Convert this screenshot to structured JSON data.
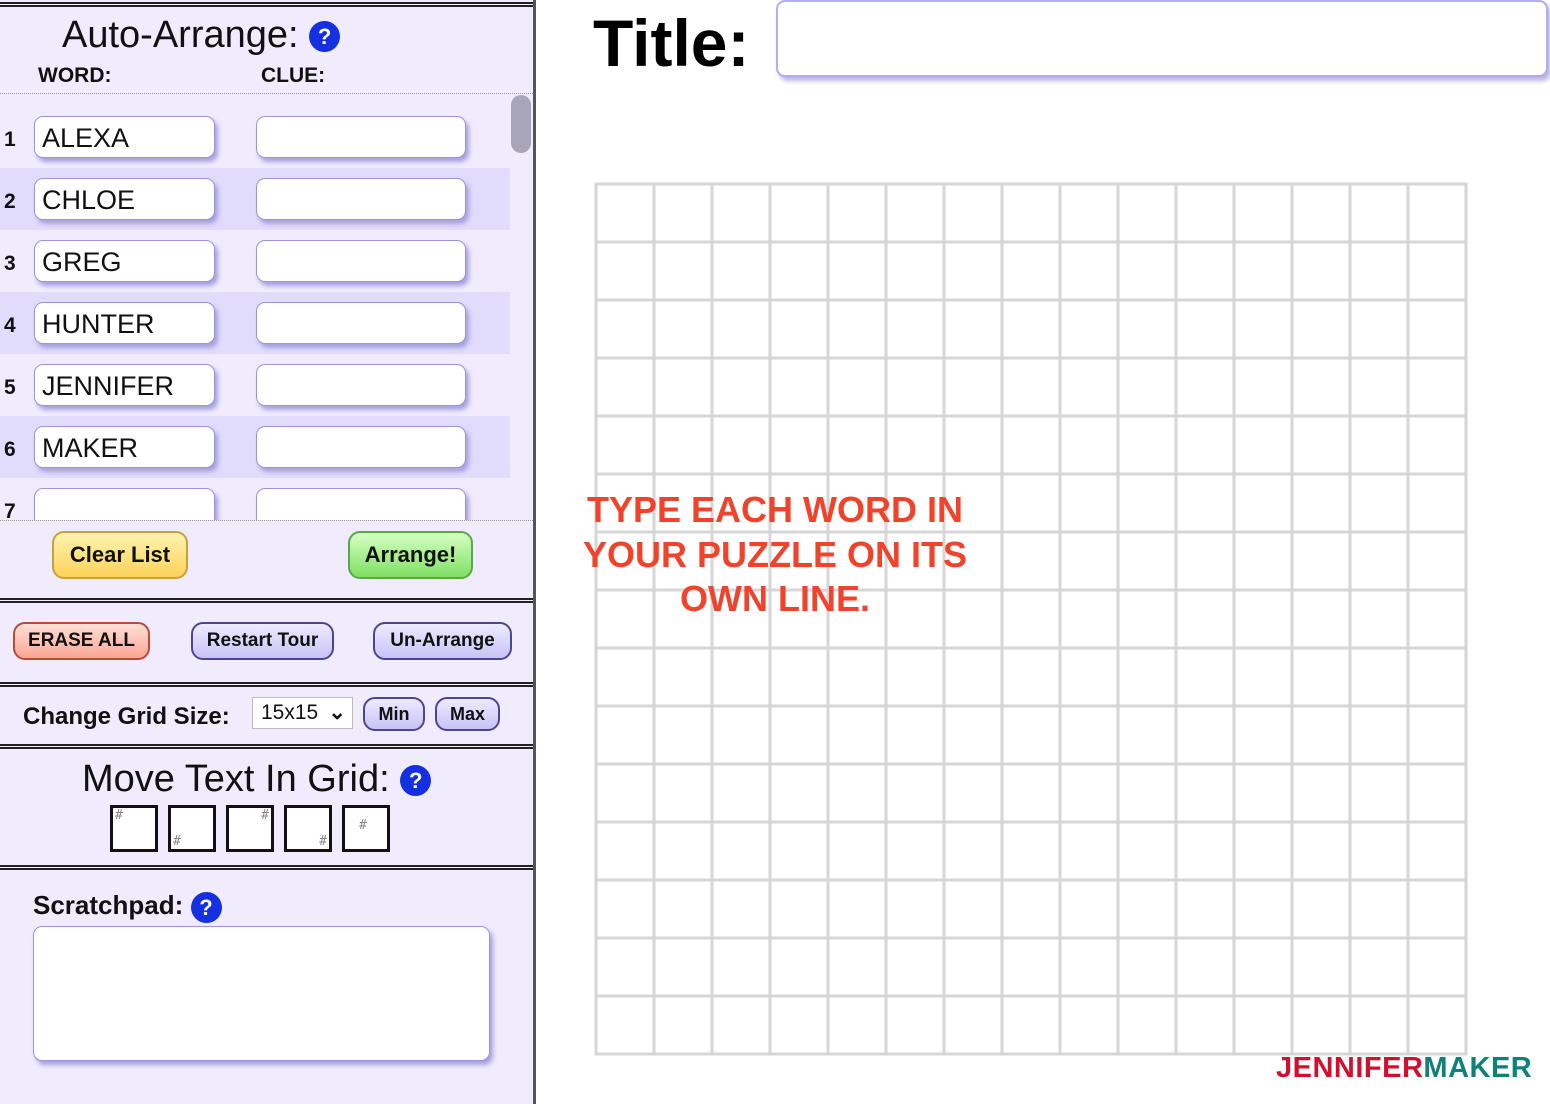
{
  "sidebar": {
    "auto_arrange_title": "Auto-Arrange:",
    "help_glyph": "?",
    "word_header": "WORD:",
    "clue_header": "CLUE:",
    "rows": [
      {
        "num": "1",
        "word": "ALEXA",
        "clue": ""
      },
      {
        "num": "2",
        "word": "CHLOE",
        "clue": ""
      },
      {
        "num": "3",
        "word": "GREG",
        "clue": ""
      },
      {
        "num": "4",
        "word": "HUNTER",
        "clue": ""
      },
      {
        "num": "5",
        "word": "JENNIFER",
        "clue": ""
      },
      {
        "num": "6",
        "word": "MAKER",
        "clue": ""
      },
      {
        "num": "7",
        "word": "",
        "clue": ""
      }
    ],
    "clear_list": "Clear List",
    "arrange": "Arrange!",
    "erase_all": "ERASE ALL",
    "restart_tour": "Restart Tour",
    "un_arrange": "Un-Arrange",
    "grid_size_label": "Change Grid Size:",
    "grid_size_value": "15x15",
    "min": "Min",
    "max": "Max",
    "move_text_title": "Move Text In Grid:",
    "move_buttons": [
      "move-top-left",
      "move-bottom-left",
      "move-top-right",
      "move-bottom-right",
      "move-center"
    ],
    "scratchpad_label": "Scratchpad:",
    "scratchpad_value": ""
  },
  "main": {
    "title_label": "Title:",
    "title_value": "",
    "grid_rows": 15,
    "grid_cols": 15,
    "instruction": "TYPE EACH WORD IN YOUR PUZZLE ON ITS OWN LINE.",
    "logo": {
      "part1": "JENNIFER",
      "part2": "MAKER",
      "color1": "#d0102e",
      "color2": "#12807a"
    }
  },
  "colors": {
    "accent": "#1530e0",
    "instruction": "#f1432c",
    "panel": "#f0ecfd"
  }
}
